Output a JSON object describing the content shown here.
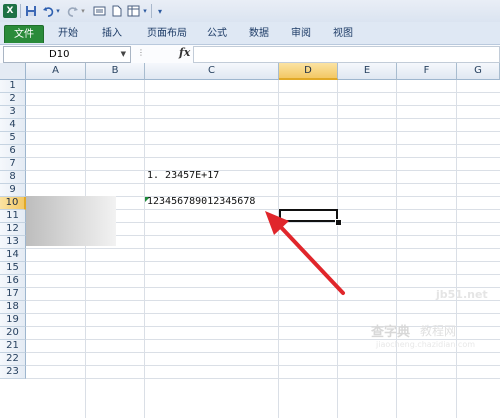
{
  "quick_access": {
    "icons": [
      "excel-logo",
      "save-icon",
      "undo-icon",
      "redo-icon",
      "print-icon",
      "new-icon",
      "table-icon",
      "customize-icon"
    ]
  },
  "ribbon": {
    "tabs": [
      {
        "label": "文件",
        "active": true
      },
      {
        "label": "开始"
      },
      {
        "label": "插入"
      },
      {
        "label": "页面布局"
      },
      {
        "label": "公式"
      },
      {
        "label": "数据"
      },
      {
        "label": "审阅"
      },
      {
        "label": "视图"
      }
    ]
  },
  "formula_bar": {
    "name_box": "D10",
    "fx_label": "fx",
    "formula": ""
  },
  "grid": {
    "columns": [
      "A",
      "B",
      "C",
      "D",
      "E",
      "F",
      "G"
    ],
    "active_column": "D",
    "rows": [
      "1",
      "2",
      "3",
      "4",
      "5",
      "6",
      "7",
      "8",
      "9",
      "10",
      "11",
      "12",
      "13",
      "14",
      "15",
      "16",
      "17",
      "18",
      "19",
      "20",
      "21",
      "22",
      "23"
    ],
    "active_row": "10",
    "cells": {
      "C7": "1. 23457E+17",
      "C9": "123456789012345678"
    },
    "selected_cell": "D10"
  },
  "watermark": {
    "site": "jb51.net",
    "brand": "查字典",
    "sub": "教程网",
    "url": "jiaocheng.chazidian.com"
  },
  "colors": {
    "file_tab": "#2a8b3a",
    "active_header": "#f3c865",
    "arrow": "#e0262b",
    "error_triangle": "#1e8a3a"
  }
}
